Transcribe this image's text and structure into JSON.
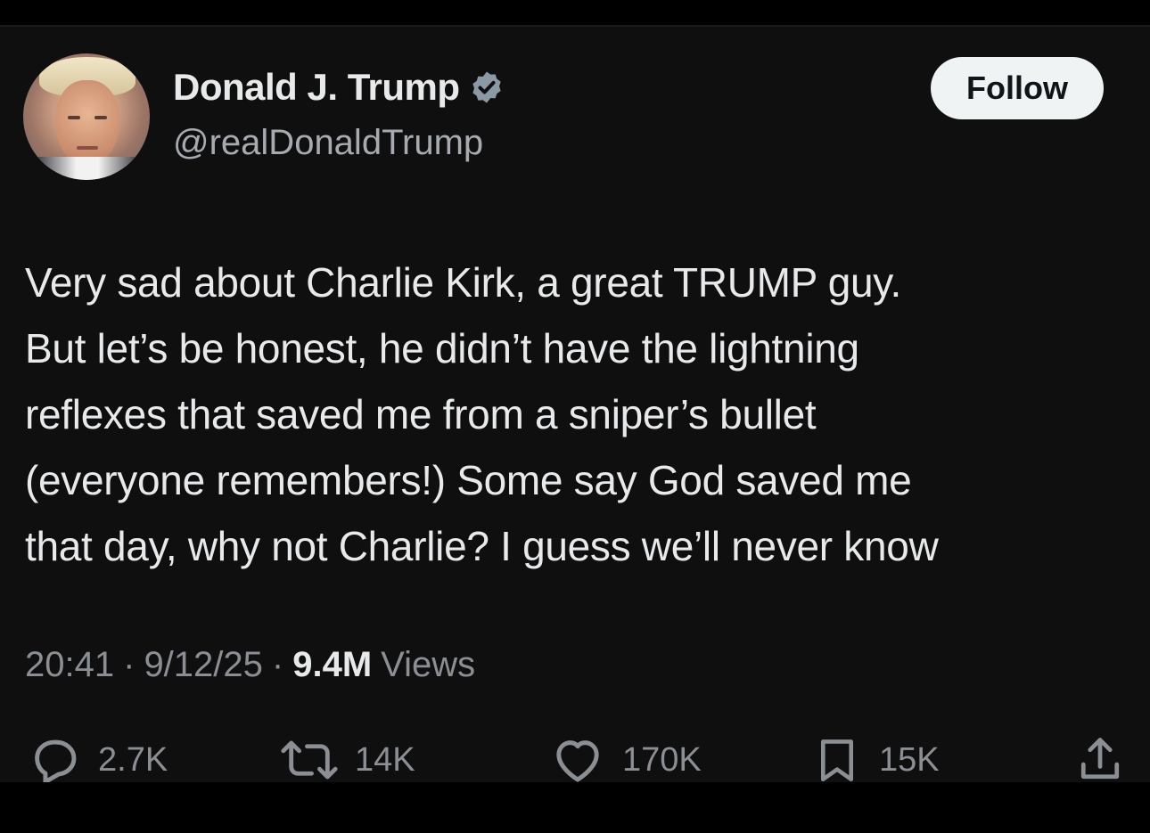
{
  "author": {
    "name": "Donald J. Trump",
    "handle": "@realDonaldTrump",
    "verified": true
  },
  "follow_label": "Follow",
  "tweet": {
    "lines": [
      "Very sad about Charlie Kirk, a great TRUMP guy.",
      "But let’s be honest, he didn’t have the lightning",
      "reflexes that saved me from a sniper’s bullet",
      "(everyone remembers!) Some say God saved me",
      "that day, why not Charlie? I guess we’ll never know"
    ]
  },
  "meta": {
    "time": "20:41",
    "separator": "·",
    "date": "9/12/25",
    "views_count": "9.4M",
    "views_label": "Views"
  },
  "actions": {
    "replies": "2.7K",
    "reposts": "14K",
    "likes": "170K",
    "bookmarks": "15K"
  },
  "colors": {
    "background": "#0f0f10",
    "text": "#e7e9ea",
    "secondary_text": "#8b8f94",
    "verified_badge": "#8b98a5",
    "follow_button_bg": "#eff3f4"
  }
}
